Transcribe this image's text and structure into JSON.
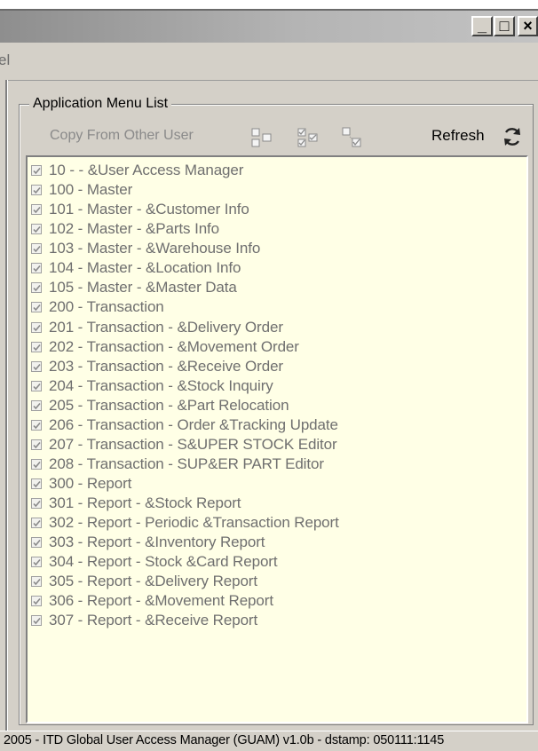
{
  "window": {
    "controls": {
      "minimize": "_",
      "maximize": "□",
      "close": "×"
    }
  },
  "menubar": {
    "fragment": "el"
  },
  "panel": {
    "group_title": "Application Menu List",
    "toolbar": {
      "copy_label": "Copy From Other User",
      "refresh_label": "Refresh",
      "icons": [
        "unselect-all-icon",
        "select-all-icon",
        "invert-selection-icon",
        "refresh-icon"
      ]
    },
    "items": [
      {
        "label": "10 -  - &User Access Manager",
        "checked": true
      },
      {
        "label": "100 - Master",
        "checked": true
      },
      {
        "label": "101 - Master - &Customer Info",
        "checked": true
      },
      {
        "label": "102 - Master - &Parts Info",
        "checked": true
      },
      {
        "label": "103 - Master - &Warehouse Info",
        "checked": true
      },
      {
        "label": "104 - Master - &Location Info",
        "checked": true
      },
      {
        "label": "105 - Master - &Master Data",
        "checked": true
      },
      {
        "label": "200 - Transaction",
        "checked": true
      },
      {
        "label": "201 - Transaction - &Delivery Order",
        "checked": true
      },
      {
        "label": "202 - Transaction - &Movement Order",
        "checked": true
      },
      {
        "label": "203 - Transaction - &Receive Order",
        "checked": true
      },
      {
        "label": "204 - Transaction - &Stock Inquiry",
        "checked": true
      },
      {
        "label": "205 - Transaction - &Part Relocation",
        "checked": true
      },
      {
        "label": "206 - Transaction - Order &Tracking Update",
        "checked": true
      },
      {
        "label": "207 - Transaction - S&UPER STOCK Editor",
        "checked": true
      },
      {
        "label": "208 - Transaction - SUP&ER PART Editor",
        "checked": true
      },
      {
        "label": "300 - Report",
        "checked": true
      },
      {
        "label": "301 - Report - &Stock Report",
        "checked": true
      },
      {
        "label": "302 - Report - Periodic &Transaction Report",
        "checked": true
      },
      {
        "label": "303 - Report - &Inventory Report",
        "checked": true
      },
      {
        "label": "304 - Report - Stock &Card Report",
        "checked": true
      },
      {
        "label": "305 - Report - &Delivery Report",
        "checked": true
      },
      {
        "label": "306 - Report - &Movement Report",
        "checked": true
      },
      {
        "label": "307 - Report - &Receive Report",
        "checked": true
      }
    ]
  },
  "statusbar": {
    "text": "2005 - ITD Global User Access Manager (GUAM) v1.0b - dstamp: 050111:1145"
  },
  "colors": {
    "face": "#d4d0c8",
    "list_background": "#ffffe6",
    "disabled_text": "#6f6f6f"
  }
}
